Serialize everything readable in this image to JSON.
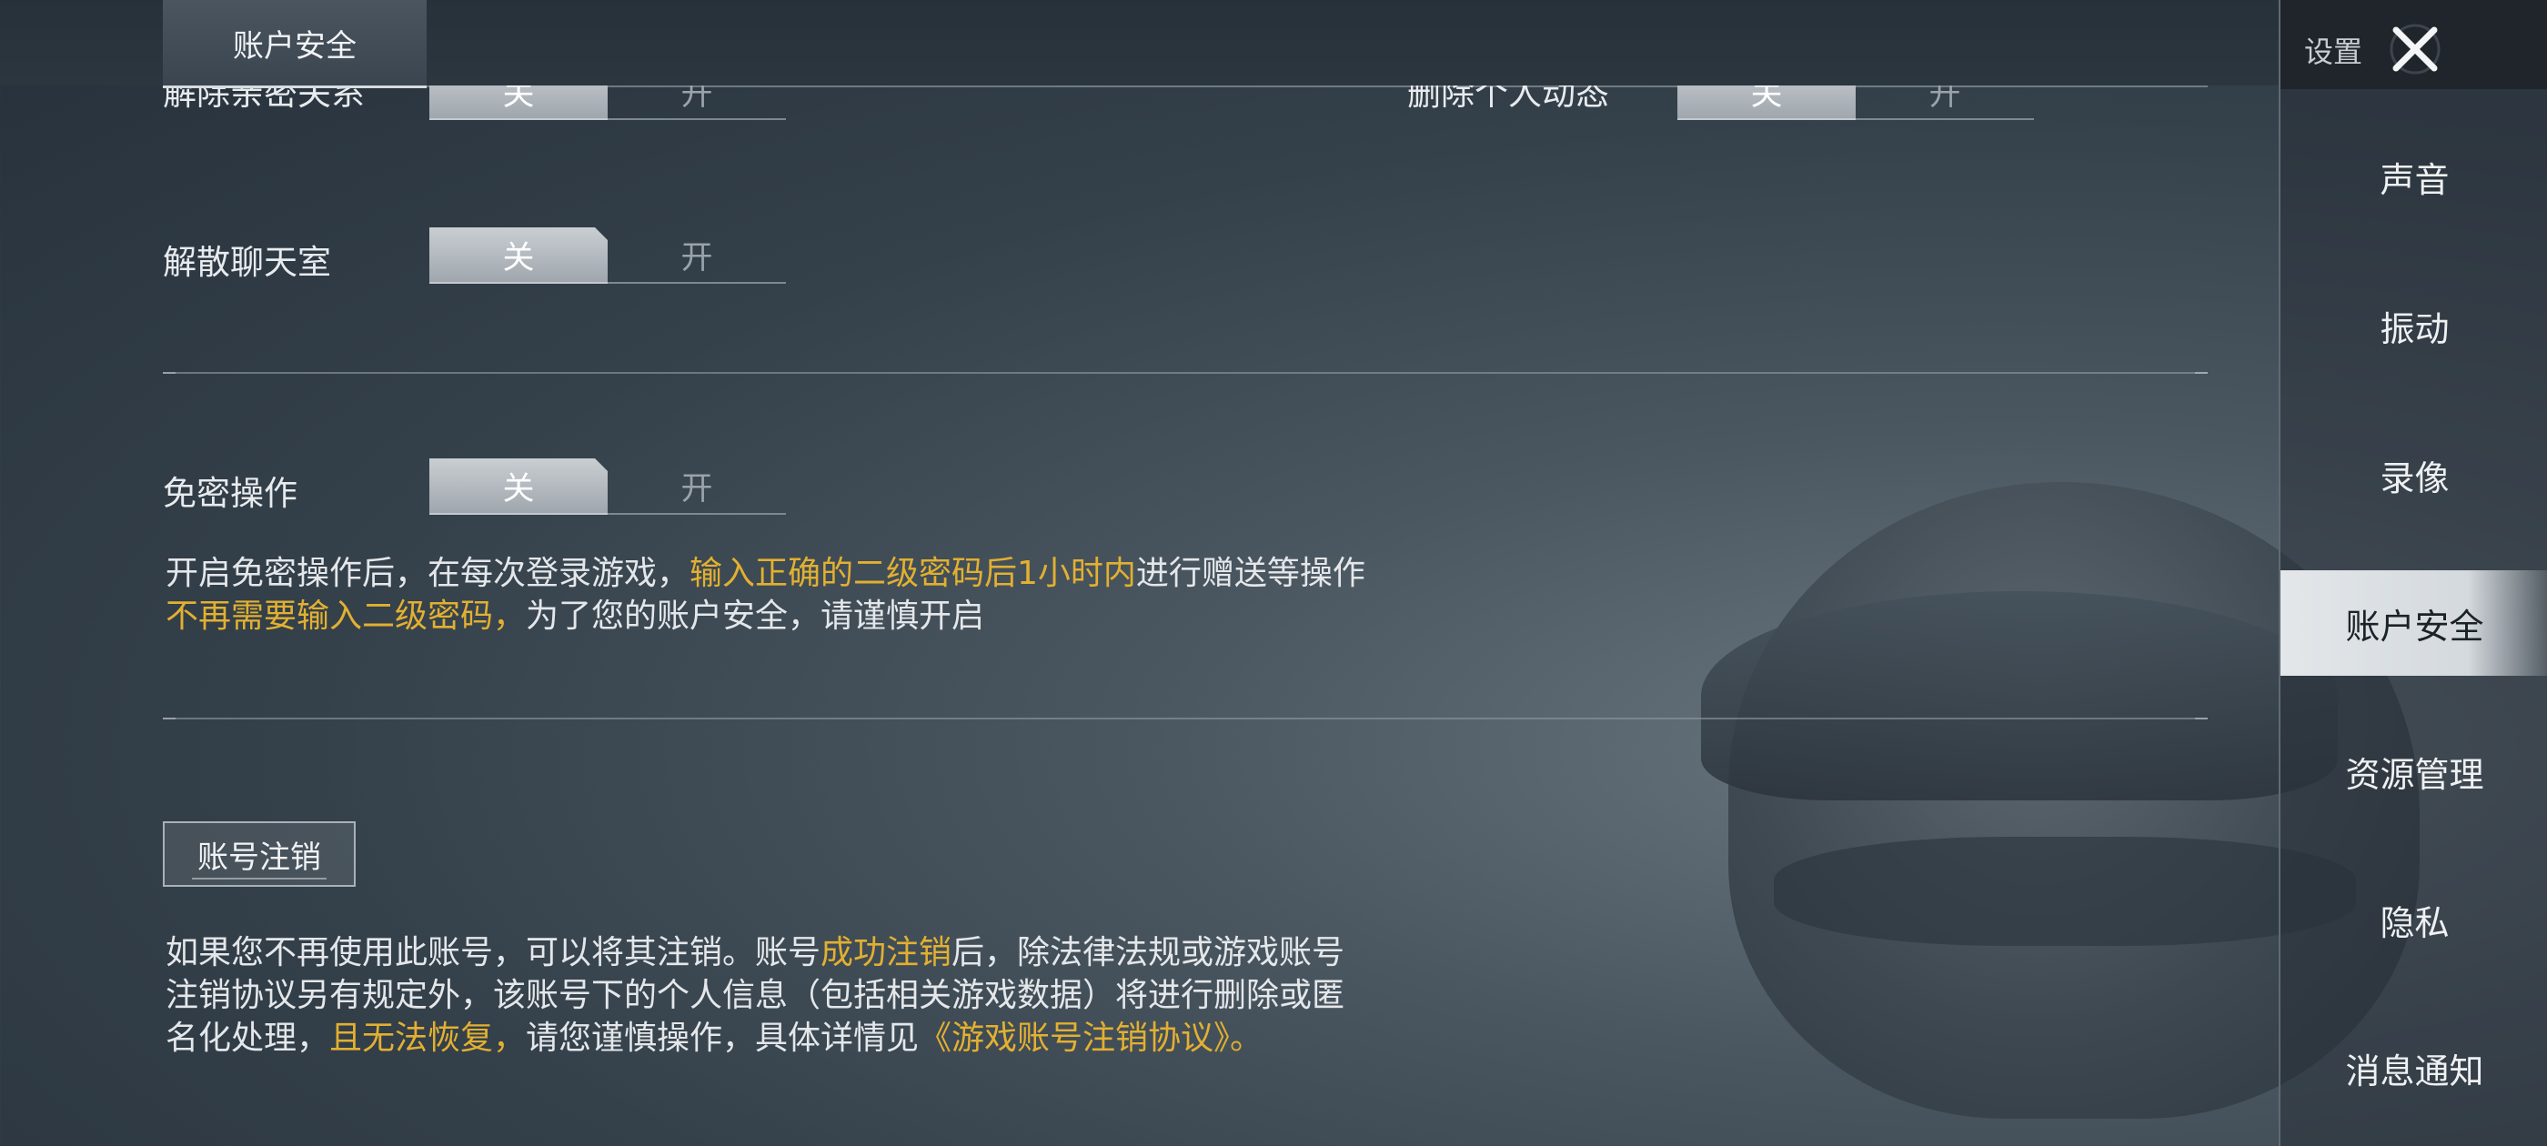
{
  "top_tab": {
    "label": "账户安全"
  },
  "settings_rows": [
    {
      "label": "解除亲密关系",
      "off_label": "关",
      "on_label": "开"
    },
    {
      "label": "删除个人动态",
      "off_label": "关",
      "on_label": "开"
    },
    {
      "label": "解散聊天室",
      "off_label": "关",
      "on_label": "开"
    }
  ],
  "password_free": {
    "label": "免密操作",
    "off_label": "关",
    "on_label": "开",
    "desc_line1": {
      "a": "开启免密操作后，在每次登录游戏，",
      "b": "输入正确的二级密码后1小时内",
      "c": "进行赠送等操作"
    },
    "desc_line2": {
      "a": "不再需要输入二级密码，",
      "b": "为了您的账户安全，请谨慎开启"
    }
  },
  "account_cancel": {
    "button_label": "账号注销",
    "line1": {
      "a": "如果您不再使用此账号，可以将其注销。账号",
      "b": "成功注销",
      "c": "后，除法律法规或游戏账号"
    },
    "line2": {
      "a": "注销协议另有规定外，该账号下的个人信息（包括相关游戏数据）将进行删除或匿"
    },
    "line3": {
      "a": "名化处理，",
      "b": "且无法恢复，",
      "c": "请您谨慎操作，具体详情见",
      "d": "《游戏账号注销协议》。"
    }
  },
  "sidebar": {
    "title": "设置",
    "items": [
      {
        "label": "声音",
        "active": false
      },
      {
        "label": "振动",
        "active": false
      },
      {
        "label": "录像",
        "active": false
      },
      {
        "label": "账户安全",
        "active": true
      },
      {
        "label": "资源管理",
        "active": false
      },
      {
        "label": "隐私",
        "active": false
      },
      {
        "label": "消息通知",
        "active": false
      }
    ]
  },
  "colors": {
    "highlight": "#e2b031",
    "toggle_off_bg": "#b8bec4",
    "active_sidebar_bg": "#dde1e4"
  }
}
